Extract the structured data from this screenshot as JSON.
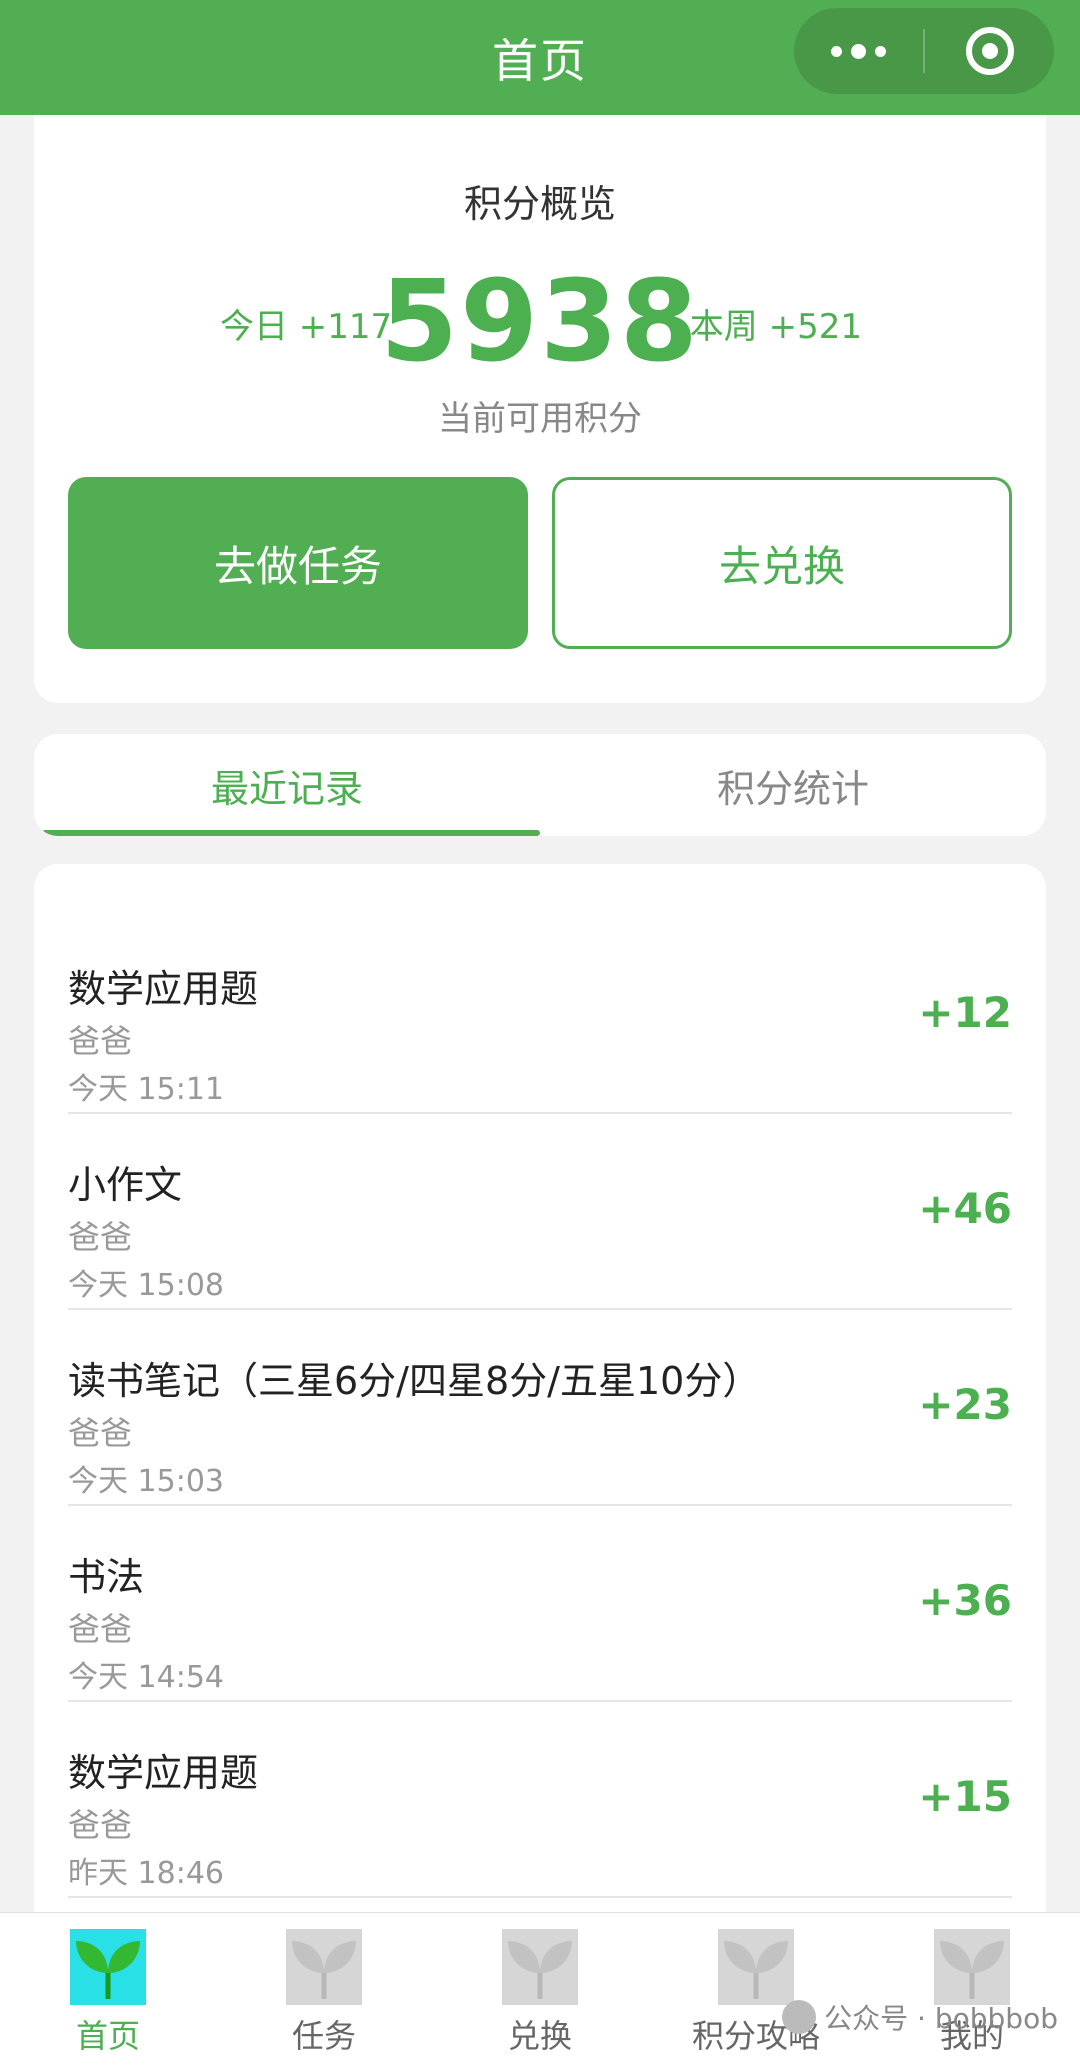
{
  "header": {
    "title": "首页"
  },
  "overview": {
    "title": "积分概览",
    "today_label": "今日 +117",
    "points": "5938",
    "week_label": "本周 +521",
    "caption": "当前可用积分",
    "primary_button": "去做任务",
    "secondary_button": "去兑换"
  },
  "tabs": [
    {
      "label": "最近记录",
      "active": true
    },
    {
      "label": "积分统计",
      "active": false
    }
  ],
  "records": [
    {
      "title": "数学应用题",
      "who": "爸爸",
      "time": "今天 15:11",
      "points": "+12"
    },
    {
      "title": "小作文",
      "who": "爸爸",
      "time": "今天 15:08",
      "points": "+46"
    },
    {
      "title": "读书笔记（三星6分/四星8分/五星10分）",
      "who": "爸爸",
      "time": "今天 15:03",
      "points": "+23"
    },
    {
      "title": "书法",
      "who": "爸爸",
      "time": "今天 14:54",
      "points": "+36"
    },
    {
      "title": "数学应用题",
      "who": "爸爸",
      "time": "昨天 18:46",
      "points": "+15"
    }
  ],
  "nav": [
    {
      "label": "首页",
      "icon": "sprout-icon",
      "active": true
    },
    {
      "label": "任务",
      "icon": "sprout-icon",
      "active": false
    },
    {
      "label": "兑换",
      "icon": "sprout-icon",
      "active": false
    },
    {
      "label": "积分攻略",
      "icon": "sprout-icon",
      "active": false
    },
    {
      "label": "我的",
      "icon": "sprout-icon",
      "active": false
    }
  ],
  "watermark": "公众号 · bobbbob",
  "colors": {
    "brand": "#52ae52",
    "accent_text": "#4caf50",
    "active_icon_bg": "#29e0e6"
  }
}
